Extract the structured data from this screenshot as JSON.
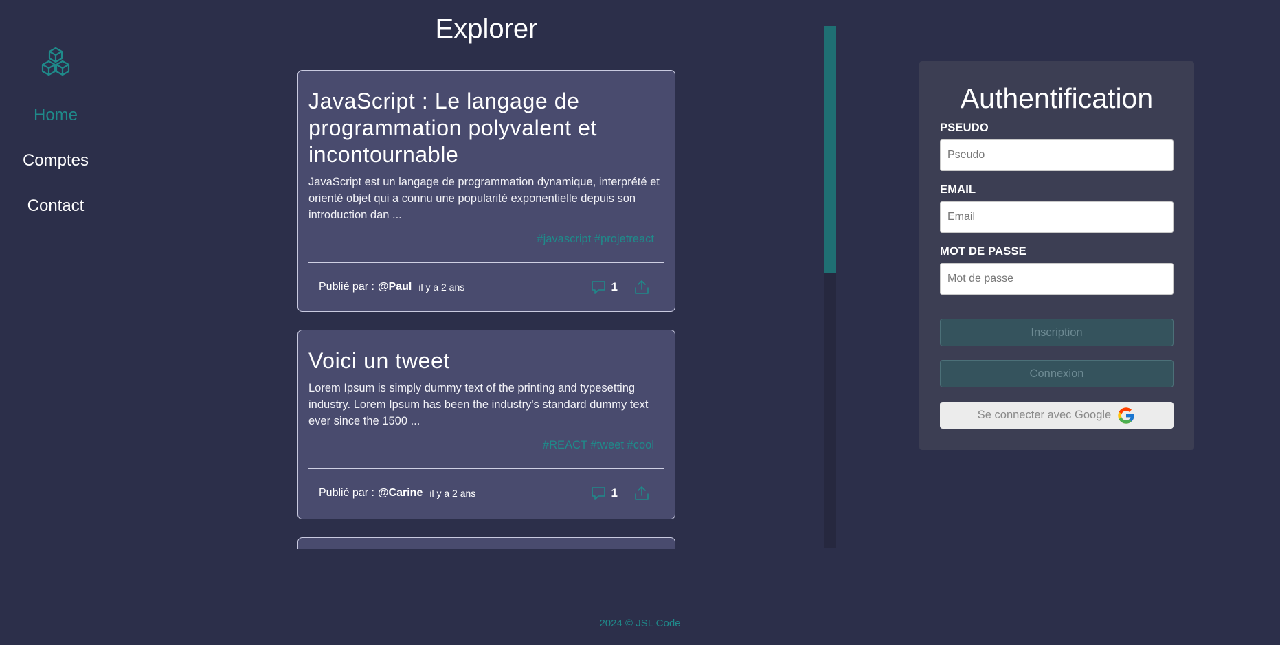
{
  "nav": {
    "logo_icon": "cubes-icon",
    "items": [
      {
        "label": "Home",
        "active": true
      },
      {
        "label": "Comptes",
        "active": false
      },
      {
        "label": "Contact",
        "active": false
      }
    ]
  },
  "feed": {
    "title": "Explorer",
    "posts": [
      {
        "title": "JavaScript : Le langage de programmation polyvalent et incontournable",
        "body": "JavaScript est un langage de programmation dynamique, interprété et orienté objet qui a connu une popularité exponentielle depuis son introduction dan ...",
        "tags": "#javascript #projetreact",
        "published_label": "Publié par :",
        "author": "@Paul",
        "when": "il y a 2 ans",
        "comments": "1"
      },
      {
        "title": "Voici un tweet",
        "body": "Lorem Ipsum is simply dummy text of the printing and typesetting industry. Lorem Ipsum has been the industry's standard dummy text ever since the 1500 ...",
        "tags": "#REACT #tweet #cool",
        "published_label": "Publié par :",
        "author": "@Carine",
        "when": "il y a 2 ans",
        "comments": "1"
      }
    ]
  },
  "auth": {
    "title": "Authentification",
    "pseudo_label": "PSEUDO",
    "pseudo_placeholder": "Pseudo",
    "email_label": "EMAIL",
    "email_placeholder": "Email",
    "password_label": "MOT DE PASSE",
    "password_placeholder": "Mot de passe",
    "signup_label": "Inscription",
    "login_label": "Connexion",
    "google_label": "Se connecter avec Google"
  },
  "footer": {
    "copyright": "2024 © JSL Code"
  },
  "colors": {
    "background": "#2c2f4a",
    "accent": "#1f8a8a",
    "card": "#494b6e",
    "panel": "#3c3e53"
  }
}
